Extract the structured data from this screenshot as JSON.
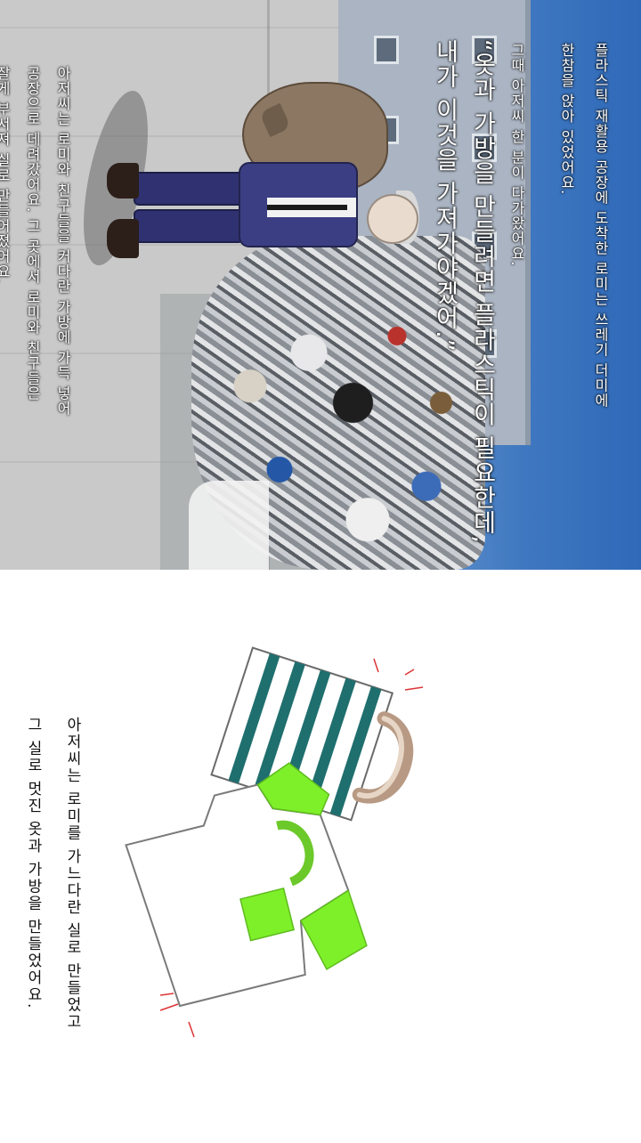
{
  "scene": {
    "lines": [
      "플라스틱 재활용 공장에 도착한 로미는 쓰레기 더미에",
      "한참을 앉아 있었어요.",
      "그때 아저씨 한 분이 다가왔어요.",
      "“옷과 가방을 만들려면 플라스틱이 필요한데,",
      "내가 이것을 가져가야겠어.”",
      "아저씨는 로미와 친구들을 커다란 가방에 가득 넣어",
      "공장으로 데려갔어요. 그 곳에서 로미와 친구들은",
      "잘게 부서져 실로 만들어졌어요."
    ]
  },
  "illustration": {
    "lines": [
      "아저씨는 로미를 가느다란 실로 만들었고",
      "그 실로 멋진 옷과 가방을 만들었어요."
    ]
  }
}
